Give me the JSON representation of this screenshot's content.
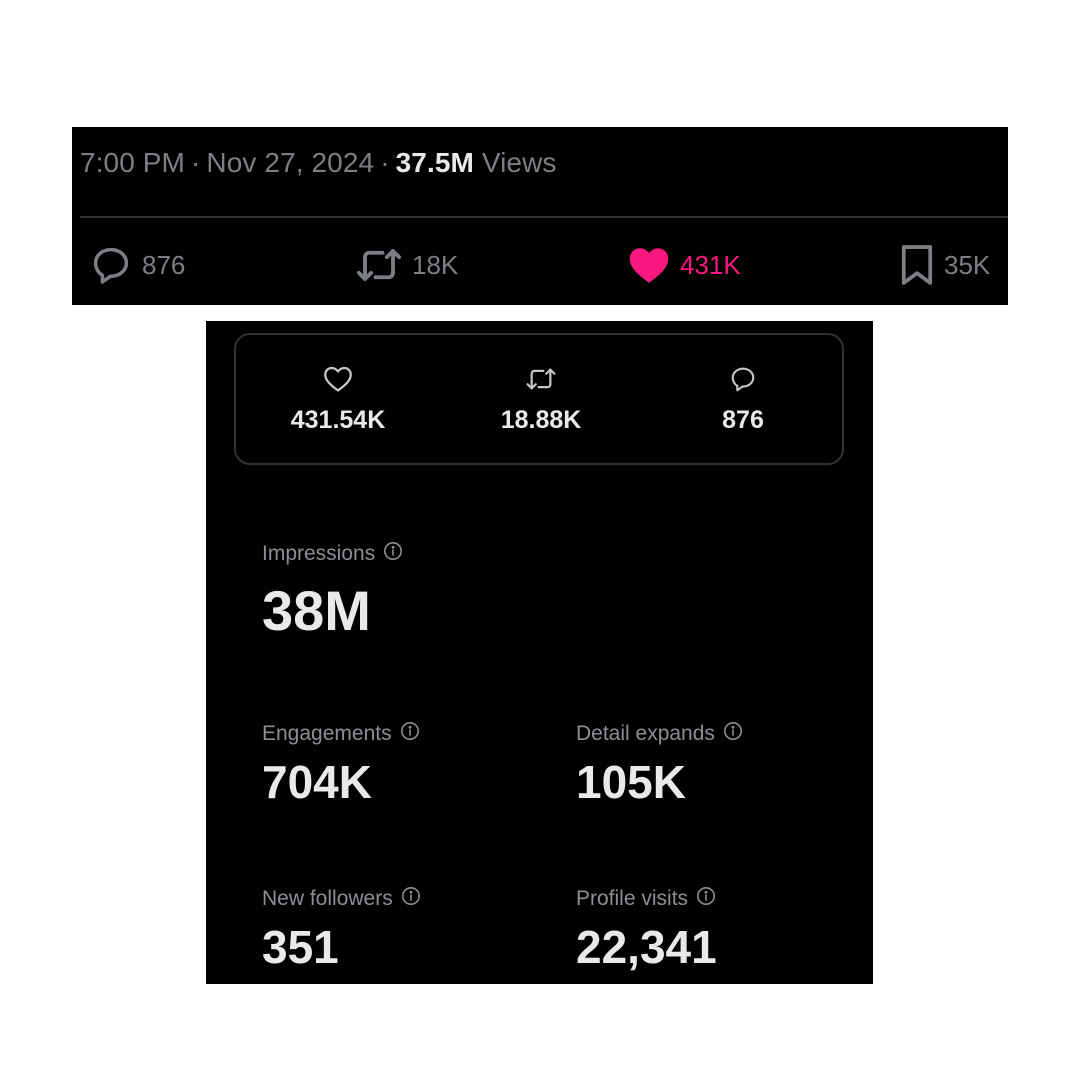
{
  "tweet": {
    "time": "7:00 PM",
    "separator": "·",
    "date": "Nov 27, 2024",
    "views_count": "37.5M",
    "views_label": "Views",
    "actions": {
      "reply": {
        "icon": "reply-bubble-icon",
        "count": "876"
      },
      "retweet": {
        "icon": "retweet-icon",
        "count": "18K"
      },
      "like": {
        "icon": "heart-filled-icon",
        "count": "431K",
        "color": "#f91880",
        "state": "liked"
      },
      "bookmark": {
        "icon": "bookmark-icon",
        "count": "35K"
      }
    }
  },
  "analytics": {
    "summary": {
      "likes": {
        "icon": "heart-outline-icon",
        "value": "431.54K"
      },
      "reposts": {
        "icon": "retweet-icon",
        "value": "18.88K"
      },
      "replies": {
        "icon": "reply-bubble-icon",
        "value": "876"
      }
    },
    "metrics": {
      "impressions": {
        "label": "Impressions",
        "value": "38M",
        "icon": "info-icon"
      },
      "engagements": {
        "label": "Engagements",
        "value": "704K",
        "icon": "info-icon"
      },
      "detail_expands": {
        "label": "Detail expands",
        "value": "105K",
        "icon": "info-icon"
      },
      "new_followers": {
        "label": "New followers",
        "value": "351",
        "icon": "info-icon"
      },
      "profile_visits": {
        "label": "Profile visits",
        "value": "22,341",
        "icon": "info-icon"
      }
    }
  },
  "colors": {
    "background": "#000000",
    "text_primary": "#e7e9ea",
    "text_secondary": "#7b7f84",
    "like_pink": "#f91880",
    "border": "#2f3336"
  }
}
